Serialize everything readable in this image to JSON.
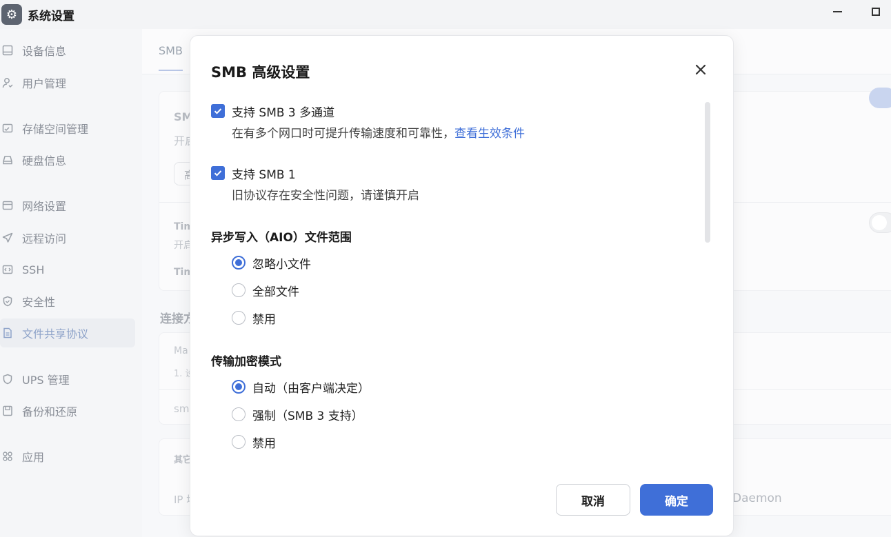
{
  "window": {
    "title": "系统设置",
    "icon": "gear-icon"
  },
  "sidebar": {
    "items": [
      {
        "label": "设备信息",
        "icon": "monitor-icon"
      },
      {
        "label": "用户管理",
        "icon": "user-icon"
      },
      {
        "label": "存储空间管理",
        "icon": "storage-icon"
      },
      {
        "label": "硬盘信息",
        "icon": "disk-icon"
      },
      {
        "label": "网络设置",
        "icon": "network-icon"
      },
      {
        "label": "远程访问",
        "icon": "send-icon"
      },
      {
        "label": "SSH",
        "icon": "code-icon"
      },
      {
        "label": "安全性",
        "icon": "shield-check-icon"
      },
      {
        "label": "文件共享协议",
        "icon": "document-icon",
        "active": true
      },
      {
        "label": "UPS 管理",
        "icon": "shield-icon"
      },
      {
        "label": "备份和还原",
        "icon": "backup-icon"
      },
      {
        "label": "应用",
        "icon": "apps-icon"
      }
    ]
  },
  "background": {
    "tab": "SMB",
    "fragments": {
      "smb_title": "SM",
      "smb_desc": "开启",
      "advanced_btn": "高",
      "tm_title": "Tim",
      "tm_desc": "开启",
      "tm_title2": "Tim",
      "conn_section": "连接方",
      "max_label": "Ma",
      "max_desc": "1. 设",
      "sm_row": "sm",
      "other_label": "其它",
      "ip_label": "IP 地",
      "daemon": "Daemon"
    }
  },
  "dialog": {
    "title": "SMB 高级设置",
    "close_icon": "close-icon",
    "multichannel": {
      "label": "支持 SMB 3 多通道",
      "desc": "在有多个网口时可提升传输速度和可靠性，",
      "link": "查看生效条件",
      "checked": true
    },
    "smb1": {
      "label": "支持 SMB 1",
      "desc": "旧协议存在安全性问题，请谨慎开启",
      "checked": true
    },
    "aio": {
      "title": "异步写入（AIO）文件范围",
      "options": [
        "忽略小文件",
        "全部文件",
        "禁用"
      ],
      "selected": 0
    },
    "encryption": {
      "title": "传输加密模式",
      "options": [
        "自动（由客户端决定）",
        "强制（SMB 3 支持）",
        "禁用"
      ],
      "selected": 0
    },
    "cancel_label": "取消",
    "ok_label": "确定"
  },
  "colors": {
    "accent": "#3f6fd8",
    "sidebar_active_text": "#8ea3c9"
  }
}
